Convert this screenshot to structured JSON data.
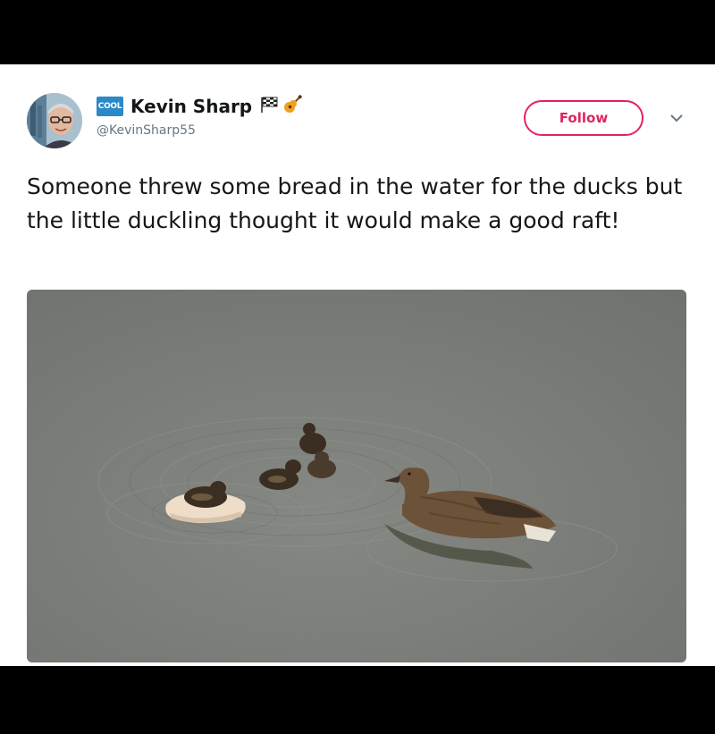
{
  "tweet": {
    "author": {
      "badge": "COOL",
      "display_name": "Kevin Sharp",
      "handle": "@KevinSharp55",
      "name_emojis": [
        "checkered-flag-icon",
        "guitar-icon"
      ]
    },
    "follow_label": "Follow",
    "text": "Someone threw some bread in the water for the ducks but the little duckling thought it would make a good raft!",
    "media": {
      "type": "photo",
      "subject": "duck-and-ducklings-in-water"
    }
  },
  "colors": {
    "follow_accent": "#e0245e",
    "text_primary": "#14171a",
    "text_secondary": "#657786",
    "badge_blue": "#2c89c7",
    "water": "#7c7f7a"
  }
}
